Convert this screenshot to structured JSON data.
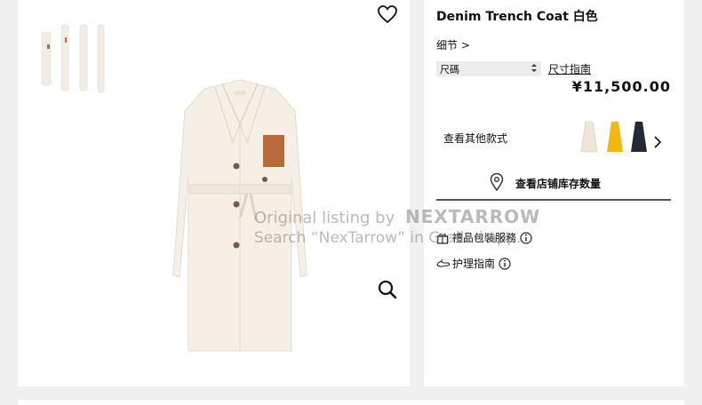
{
  "product": {
    "title": "Denim Trench Coat 白色",
    "details_link": "细节 >",
    "size_label": "尺碼",
    "size_guide": "尺寸指南",
    "price": "¥11,500.00",
    "other_styles": "查看其他款式",
    "store_stock": "查看店铺库存数量",
    "gift_wrap": "禮品包裝服務",
    "care_guide": "护理指南"
  },
  "watermark": {
    "line1_prefix": "Original listing by",
    "brand": "NEXTARROW",
    "line2": "Search “NexTarrow” in Grailed app."
  },
  "colors": {
    "swatch_white": "#efe6d8",
    "swatch_yellow": "#f2b810",
    "swatch_navy": "#222a35",
    "accent_brown": "#b96a3c"
  },
  "icons": [
    "heart-icon",
    "zoom-icon",
    "location-pin-icon",
    "gift-icon",
    "care-icon",
    "info-icon",
    "chevron-right-icon",
    "select-arrows-icon"
  ]
}
